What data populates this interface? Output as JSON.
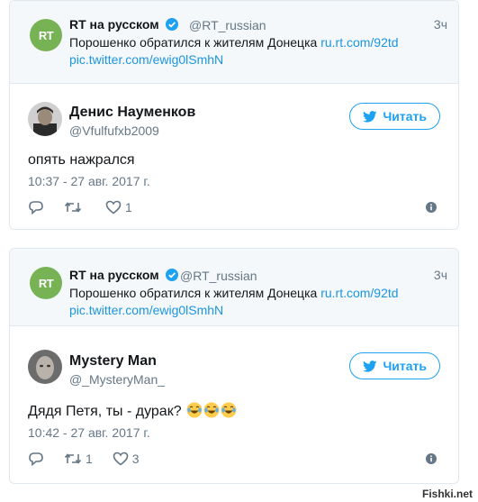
{
  "tweets": [
    {
      "quoted": {
        "avatar_text": "RT",
        "name": "RT на русском",
        "handle": "@RT_russian",
        "time": "3ч",
        "text": "Порошенко обратился к жителям Донецка",
        "link": "ru.rt.com/92td",
        "pic_link": "pic.twitter.com/ewig0lSmhN"
      },
      "author": {
        "name": "Денис Науменков",
        "handle": "@Vfulfufxb2009"
      },
      "follow_label": "Читать",
      "text": "опять нажрался",
      "date": "10:37 - 27 авг. 2017 г.",
      "retweets": "",
      "likes": "1"
    },
    {
      "quoted": {
        "avatar_text": "RT",
        "name": "RT на русском",
        "handle": "@RT_russian",
        "time": "3ч",
        "text": "Порошенко обратился к жителям Донецка",
        "link": "ru.rt.com/92td",
        "pic_link": "pic.twitter.com/ewig0lSmhN"
      },
      "author": {
        "name": "Mystery Man",
        "handle": "@_MysteryMan_"
      },
      "follow_label": "Читать",
      "text": "Дядя Петя, ты - дурак?",
      "emoji": [
        "face-with-tears-of-joy",
        "face-with-tears-of-joy",
        "face-with-tears-of-joy"
      ],
      "date": "10:42 - 27 авг. 2017 г.",
      "retweets": "1",
      "likes": "3"
    }
  ],
  "watermark": "Fishki.net",
  "colors": {
    "accent": "#1da1f2",
    "link": "#1b95e0",
    "rt_green": "#77b255",
    "muted": "#657786"
  }
}
